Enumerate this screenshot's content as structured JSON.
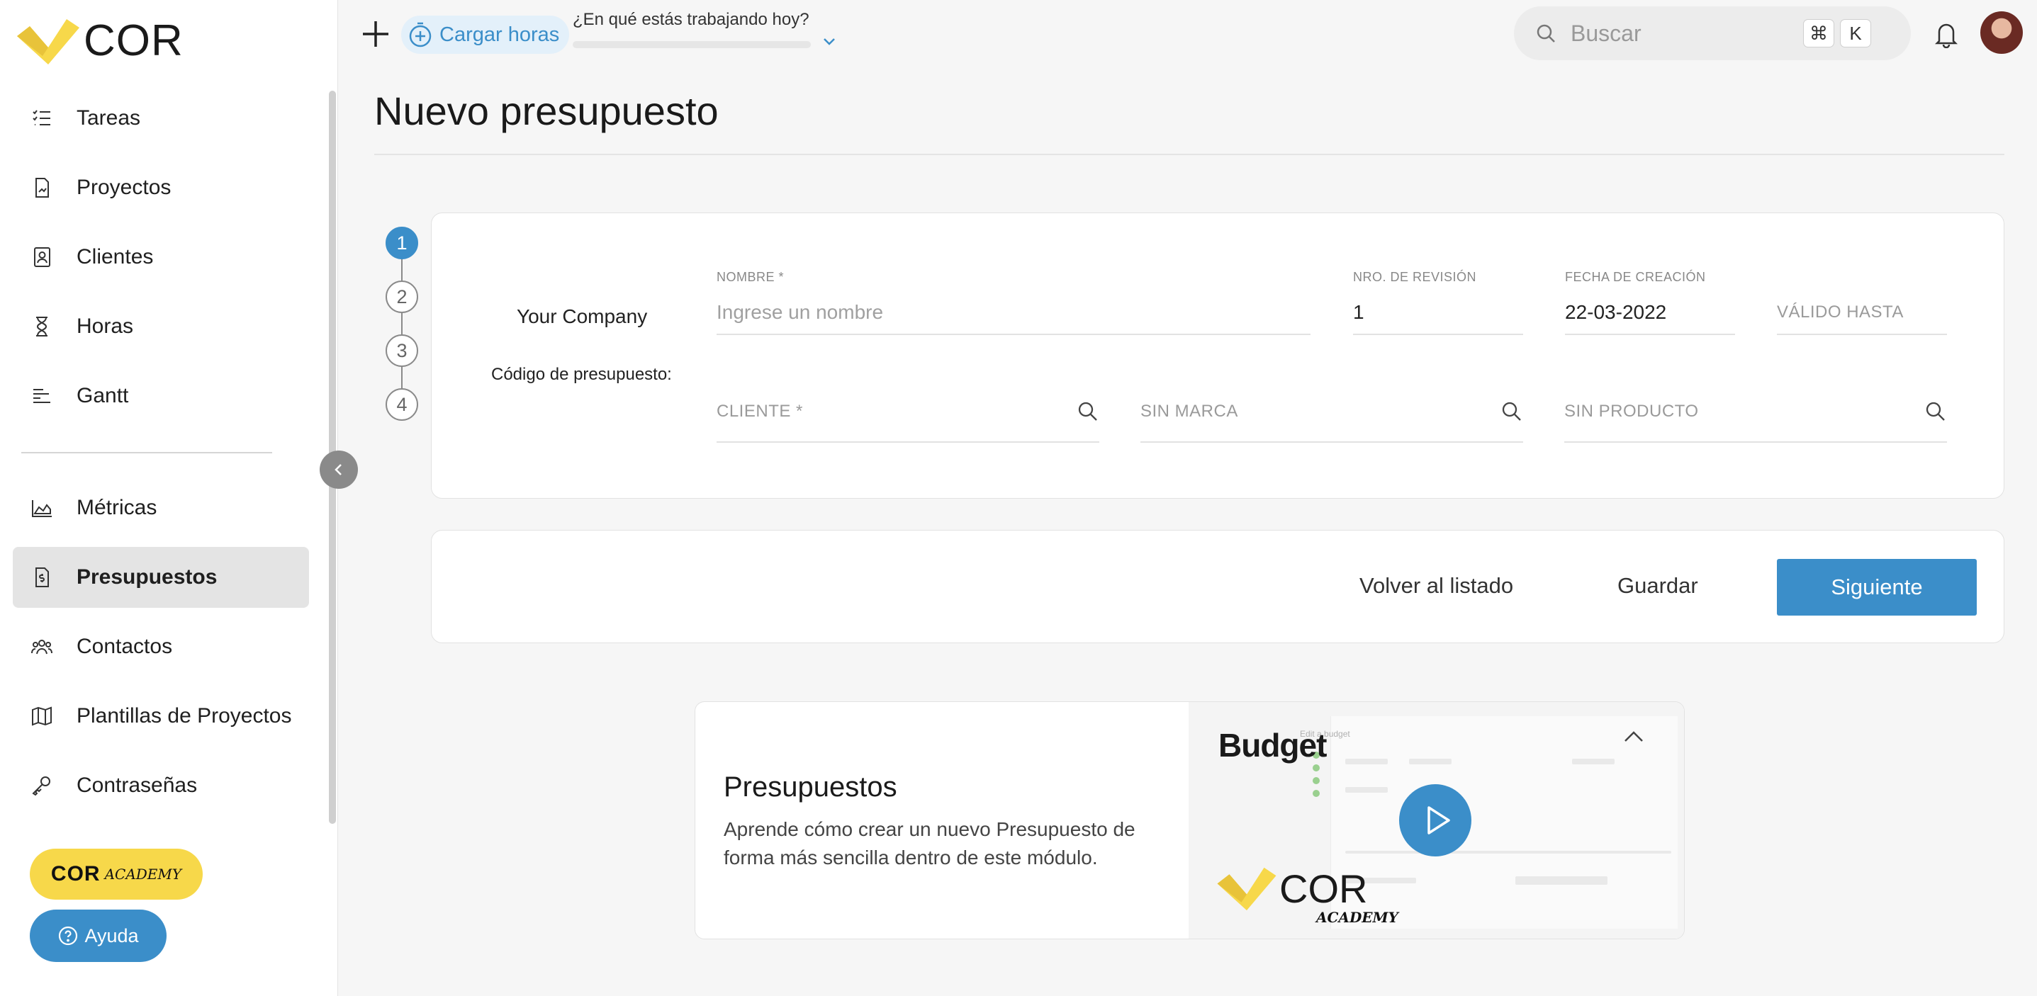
{
  "brand": {
    "logo_text": "COR",
    "primary_color": "#3b8ec9",
    "accent_yellow": "#f7d84a"
  },
  "sidebar": {
    "items": [
      {
        "label": "Tareas",
        "icon": "tasks-list-icon"
      },
      {
        "label": "Proyectos",
        "icon": "project-document-icon"
      },
      {
        "label": "Clientes",
        "icon": "client-badge-icon"
      },
      {
        "label": "Horas",
        "icon": "hourglass-icon"
      },
      {
        "label": "Gantt",
        "icon": "gantt-icon"
      },
      {
        "label": "Métricas",
        "icon": "area-chart-icon"
      },
      {
        "label": "Presupuestos",
        "icon": "budget-document-icon",
        "active": true
      },
      {
        "label": "Contactos",
        "icon": "contacts-icon"
      },
      {
        "label": "Plantillas de Proyectos",
        "icon": "map-icon"
      },
      {
        "label": "Contraseñas",
        "icon": "key-icon"
      }
    ],
    "academy": {
      "cor": "COR",
      "sub": "ACADEMY"
    },
    "help_label": "Ayuda"
  },
  "topbar": {
    "cargar_label": "Cargar horas",
    "working_label": "¿En qué estás trabajando hoy?",
    "search_placeholder": "Buscar",
    "shortcut_cmd": "⌘",
    "shortcut_key": "K"
  },
  "page": {
    "title": "Nuevo presupuesto"
  },
  "stepper": {
    "steps": [
      "1",
      "2",
      "3",
      "4"
    ],
    "active": 1
  },
  "form": {
    "company": "Your Company",
    "code_label": "Código de presupuesto:",
    "nombre_label": "NOMBRE *",
    "nombre_placeholder": "Ingrese un nombre",
    "revision_label": "NRO. DE REVISIÓN",
    "revision_value": "1",
    "fecha_label": "FECHA DE CREACIÓN",
    "fecha_value": "22-03-2022",
    "valido_placeholder": "VÁLIDO HASTA",
    "cliente_placeholder": "CLIENTE *",
    "marca_placeholder": "SIN MARCA",
    "producto_placeholder": "SIN PRODUCTO"
  },
  "actions": {
    "back_label": "Volver al listado",
    "save_label": "Guardar",
    "next_label": "Siguiente"
  },
  "promo": {
    "title": "Presupuestos",
    "description": "Aprende cómo crear un nuevo Presupuesto de forma más sencilla dentro de este módulo.",
    "video_word": "Budget",
    "video_subtitle": "Edit a budget",
    "video_logo": "COR",
    "video_logo_sub": "ACADEMY"
  }
}
